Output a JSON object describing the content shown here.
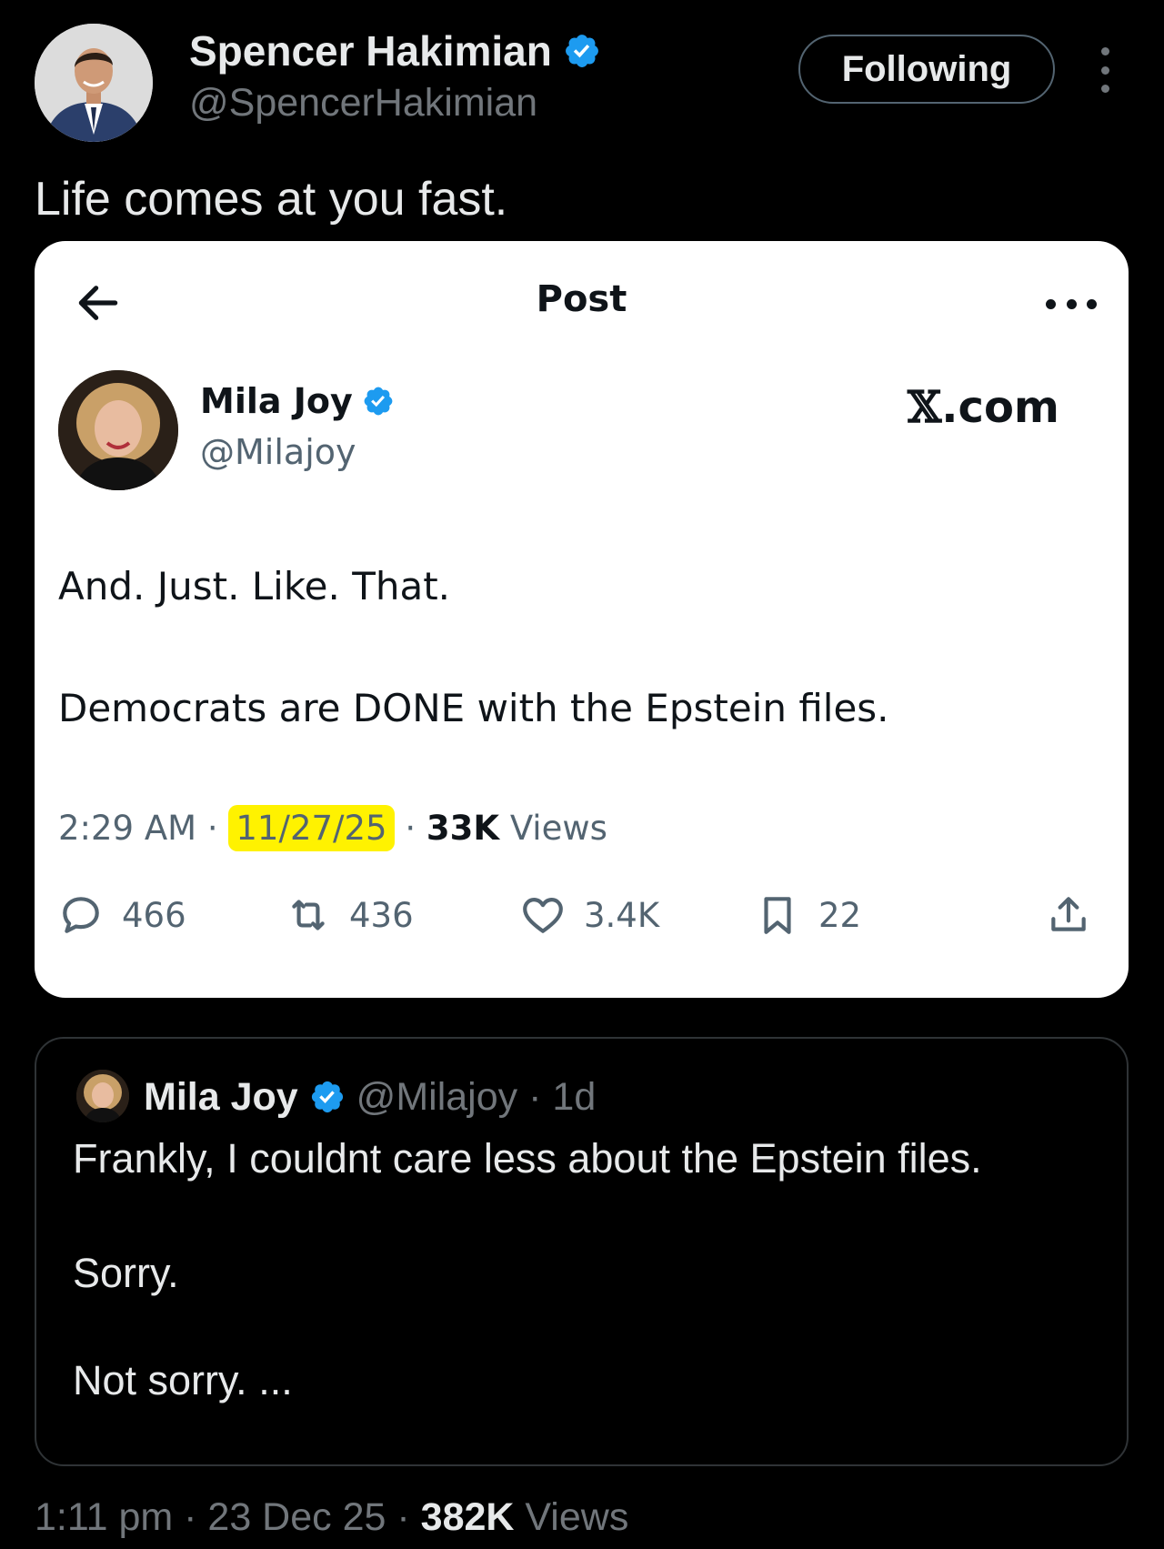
{
  "author": {
    "name": "Spencer Hakimian",
    "handle": "@SpencerHakimian",
    "follow_label": "Following"
  },
  "tweet": {
    "text": "Life comes at you fast."
  },
  "screenshot": {
    "header_title": "Post",
    "site_label": ".com",
    "author_name": "Mila Joy",
    "author_handle": "@Milajoy",
    "line1": "And. Just. Like. That.",
    "line2": "Democrats are DONE with the Epstein files.",
    "time": "2:29 AM",
    "date": "11/27/25",
    "views_count": "33K",
    "views_label": "Views",
    "highlight_color": "#fff200",
    "stats": {
      "replies": "466",
      "reposts": "436",
      "likes": "3.4K",
      "bookmarks": "22"
    }
  },
  "quote": {
    "name": "Mila Joy",
    "handle": "@Milajoy",
    "age": "· 1d",
    "line1": "Frankly, I couldnt care less about the Epstein files.",
    "line2": "Sorry.",
    "line3": "Not sorry. ..."
  },
  "footer": {
    "time": "1:11 pm",
    "date": "23 Dec 25",
    "views_count": "382K",
    "views_label": "Views"
  },
  "colors": {
    "background": "#000000",
    "verified": "#1d9bf0",
    "secondary_text": "#71767b"
  }
}
